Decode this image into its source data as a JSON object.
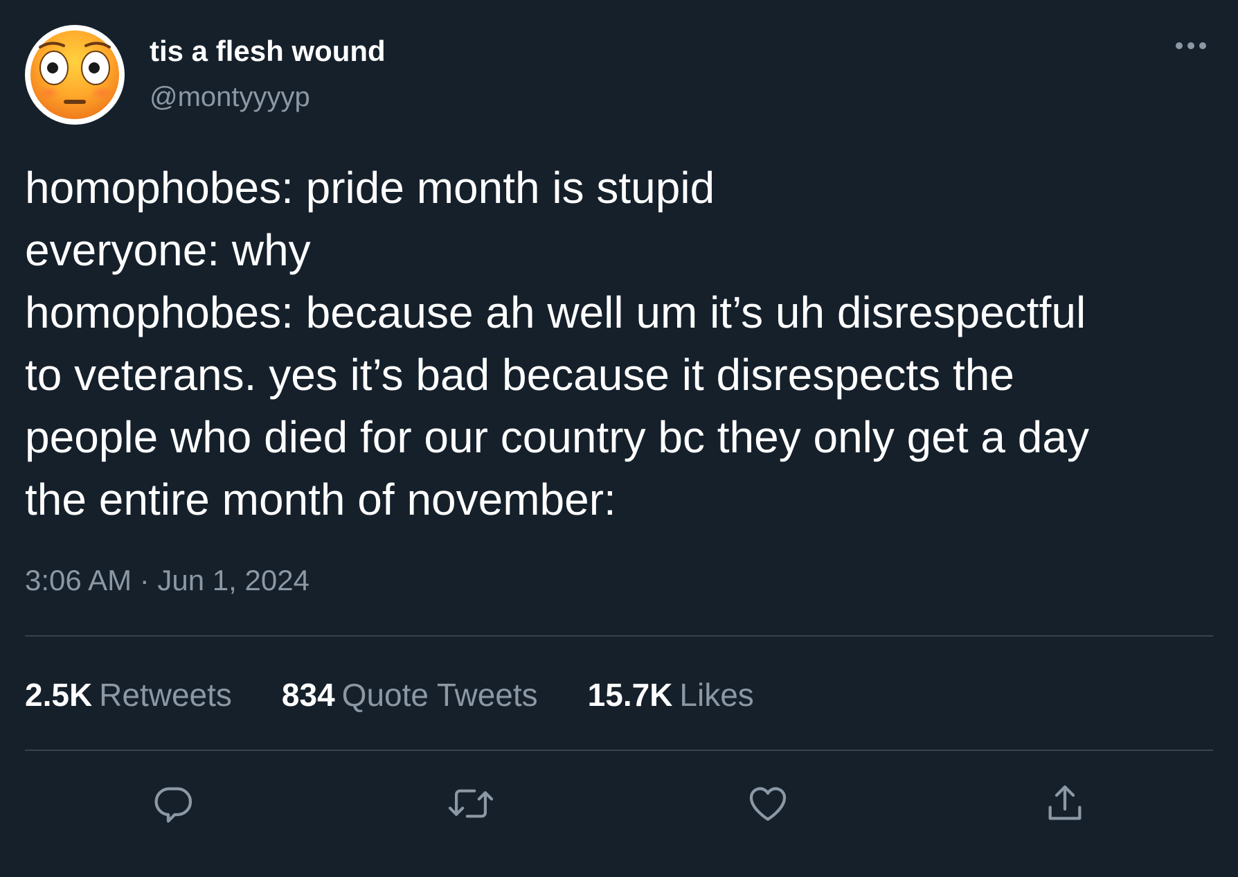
{
  "user": {
    "display_name": "tis a flesh wound",
    "handle": "@montyyyyp",
    "avatar_icon": "flushed-face-emoji"
  },
  "tweet": {
    "lines": [
      "homophobes: pride month is stupid",
      "everyone: why",
      "homophobes: because ah well um it’s uh disrespectful",
      "to veterans. yes it’s bad because it disrespects the",
      "people who died for our country bc they only get a day",
      "the entire month of november:"
    ],
    "timestamp": "3:06 AM · Jun 1, 2024"
  },
  "stats": {
    "retweets_count": "2.5K",
    "retweets_label": "Retweets",
    "quotes_count": "834",
    "quotes_label": "Quote Tweets",
    "likes_count": "15.7K",
    "likes_label": "Likes"
  },
  "actions": {
    "reply_icon": "reply-icon",
    "retweet_icon": "retweet-icon",
    "like_icon": "heart-icon",
    "share_icon": "share-icon"
  },
  "colors": {
    "background": "#15202b",
    "primary_text": "#ffffff",
    "secondary_text": "#8b98a5",
    "divider": "#38444d"
  }
}
